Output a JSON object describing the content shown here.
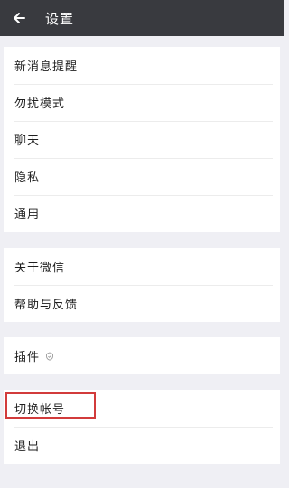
{
  "header": {
    "title": "设置",
    "back_icon": "arrow-left-icon"
  },
  "groups": [
    {
      "items": [
        "新消息提醒",
        "勿扰模式",
        "聊天",
        "隐私",
        "通用"
      ]
    },
    {
      "items": [
        "关于微信",
        "帮助与反馈"
      ]
    },
    {
      "items": [
        "插件"
      ]
    },
    {
      "items": [
        "切换帐号",
        "退出"
      ]
    }
  ],
  "colors": {
    "header_bg": "#393a3f",
    "page_bg": "#efeff4",
    "highlight": "#d23b3b"
  }
}
